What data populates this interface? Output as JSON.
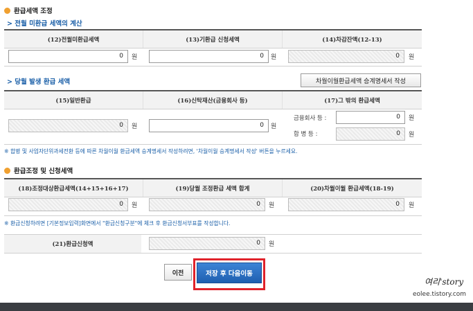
{
  "section1": {
    "title": "환급세액 조정",
    "sub1": "전월 미환급 세액의 계산",
    "headers": [
      "(12)전월미환급세액",
      "(13)기환급 신청세액",
      "(14)차감잔액(12-13)"
    ],
    "values": [
      "0",
      "0",
      "0"
    ],
    "unit": "원",
    "sub2": "당월 발생 환급 세액",
    "carry_button": "차월이월환급세액 승계명세서 작성",
    "headers2": [
      "(15)일반환급",
      "(16)신탁재산(금융회사 등)",
      "(17)그 밖의 환급세액"
    ],
    "values2": [
      "0",
      "0"
    ],
    "other_labels": [
      "금융회사 등 :",
      "합 병 등 :"
    ],
    "other_values": [
      "0",
      "0"
    ],
    "note": "※ 합병 및 사업자단위과세전환 등에 따른 차월이월 환급세액 승계명세서 작성하려면, '차월이월 승계명세서 작성' 버튼을 누르세요."
  },
  "section2": {
    "title": "환급조정 및 신청세액",
    "headers": [
      "(18)조정대상환급세액(14+15+16+17)",
      "(19)당월 조정환급 세액 합계",
      "(20)차월이월 환급세액(18-19)"
    ],
    "values": [
      "0",
      "0",
      "0"
    ],
    "note": "※ 환급신청하려면 [기본정보입력]화면에서 \"환급신청구분\"에 체크 후 환급신청서부표를 작성합니다.",
    "refund_label": "(21)환급신청액",
    "refund_value": "0"
  },
  "buttons": {
    "prev": "이전",
    "save_next": "저장 후 다음이동"
  },
  "watermark": {
    "line1": "여리'story",
    "line2": "eolee.tistory.com"
  },
  "colors": {
    "accent": "#2a6fc0",
    "highlight_box": "#e0222a",
    "bullet": "#f0a030",
    "link_blue": "#1a5fa8"
  }
}
